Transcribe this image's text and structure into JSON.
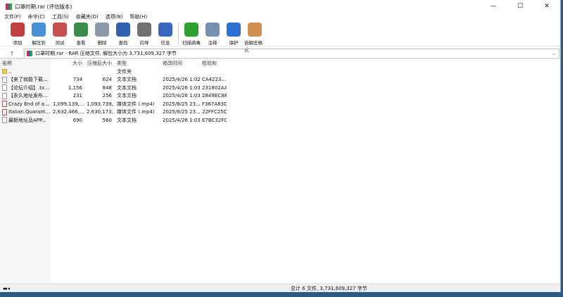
{
  "title": "口罩时期.rar (评估版本)",
  "window_controls": {
    "minimize": "—",
    "maximize": "☐",
    "close": "✕"
  },
  "menu": [
    "文件(F)",
    "命令(C)",
    "工具(S)",
    "收藏夹(O)",
    "选项(N)",
    "帮助(H)"
  ],
  "toolbar": [
    {
      "label": "添加",
      "icon": "add-icon",
      "color": "#c04040"
    },
    {
      "label": "解压到",
      "icon": "extract-folder-icon",
      "color": "#4a90d9"
    },
    {
      "label": "测试",
      "icon": "test-icon",
      "color": "#c85050"
    },
    {
      "label": "查看",
      "icon": "view-book-icon",
      "color": "#3c8c4c"
    },
    {
      "label": "删除",
      "icon": "delete-icon",
      "color": "#8a9aa8"
    },
    {
      "label": "查找",
      "icon": "find-icon",
      "color": "#3060b0"
    },
    {
      "label": "向导",
      "icon": "wizard-icon",
      "color": "#707070"
    },
    {
      "label": "信息",
      "icon": "info-icon",
      "color": "#3a68c0"
    },
    {
      "label": "扫描病毒",
      "icon": "virus-scan-icon",
      "color": "#30a030"
    },
    {
      "label": "注释",
      "icon": "comment-icon",
      "color": "#7890b0"
    },
    {
      "label": "保护",
      "icon": "protect-icon",
      "color": "#3070d0"
    },
    {
      "label": "自解压格式",
      "icon": "sfx-icon",
      "color": "#d09050"
    }
  ],
  "address": {
    "up": "↑",
    "path": "口罩时期.rar - RAR 压缩文件, 解包大小为 3,731,609,327 字节"
  },
  "columns": [
    "名称",
    "大小",
    "压缩后大小",
    "类型",
    "修改时间",
    "校验和"
  ],
  "files": [
    {
      "name": "..",
      "size": "",
      "packed": "",
      "type": "文件夹",
      "modified": "",
      "crc": "",
      "kind": "folder"
    },
    {
      "name": "【来了就能下载...",
      "size": "734",
      "packed": "624",
      "type": "文本文档",
      "modified": "2025/4/26 1:02",
      "crc": "CA4223...",
      "kind": "text"
    },
    {
      "name": "【论坛介绍】.tx...",
      "size": "1,156",
      "packed": "848",
      "type": "文本文档",
      "modified": "2025/4/26 1:03",
      "crc": "231802AA",
      "kind": "text"
    },
    {
      "name": "【永久地址发布...",
      "size": "231",
      "packed": "256",
      "type": "文本文档",
      "modified": "2025/4/26 1:03",
      "crc": "2849EC88",
      "kind": "text"
    },
    {
      "name": "Crazy End of a...",
      "size": "1,099,139,...",
      "packed": "1,093,739,...",
      "type": "媒体文件 (.mp4)",
      "modified": "2025/8/25 23...",
      "crc": "F367A83D",
      "kind": "media"
    },
    {
      "name": "Italian.Quarant...",
      "size": "2,632,466,...",
      "packed": "2,630,173,...",
      "type": "媒体文件 (.mp4)",
      "modified": "2025/8/25 23...",
      "crc": "22FFC25D",
      "kind": "media"
    },
    {
      "name": "最新地址及APP...",
      "size": "690",
      "packed": "560",
      "type": "文本文档",
      "modified": "2025/4/26 1:03",
      "crc": "E7BC32FC",
      "kind": "text"
    }
  ],
  "status": "总计 6 文件, 3,731,609,327 字节"
}
